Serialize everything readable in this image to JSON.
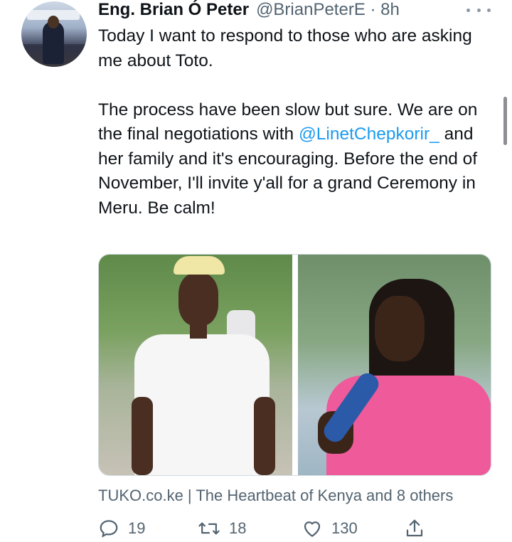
{
  "tweet": {
    "author_name": "Eng. Brian Ó Peter",
    "author_handle": "@BrianPeterE · 8h",
    "text_line_1": "Today I want to respond to those who are asking me about Toto.",
    "text_line_2a": "The process have been slow but sure. We are on the final negotiations with ",
    "mention": "@LinetChepkorir_",
    "text_line_2b": " and her family and it's encouraging. Before the end of November, I'll invite y'all for a grand Ceremony in Meru. Be calm!",
    "attribution": "TUKO.co.ke | The Heartbeat of Kenya and 8 others"
  },
  "actions": {
    "reply_count": "19",
    "retweet_count": "18",
    "like_count": "130"
  },
  "icons": [
    "more-icon",
    "reply-icon",
    "retweet-icon",
    "like-icon",
    "share-icon"
  ],
  "colors": {
    "mention": "#1d9bf0",
    "secondary_text": "#536471",
    "primary_text": "#0f1419"
  }
}
